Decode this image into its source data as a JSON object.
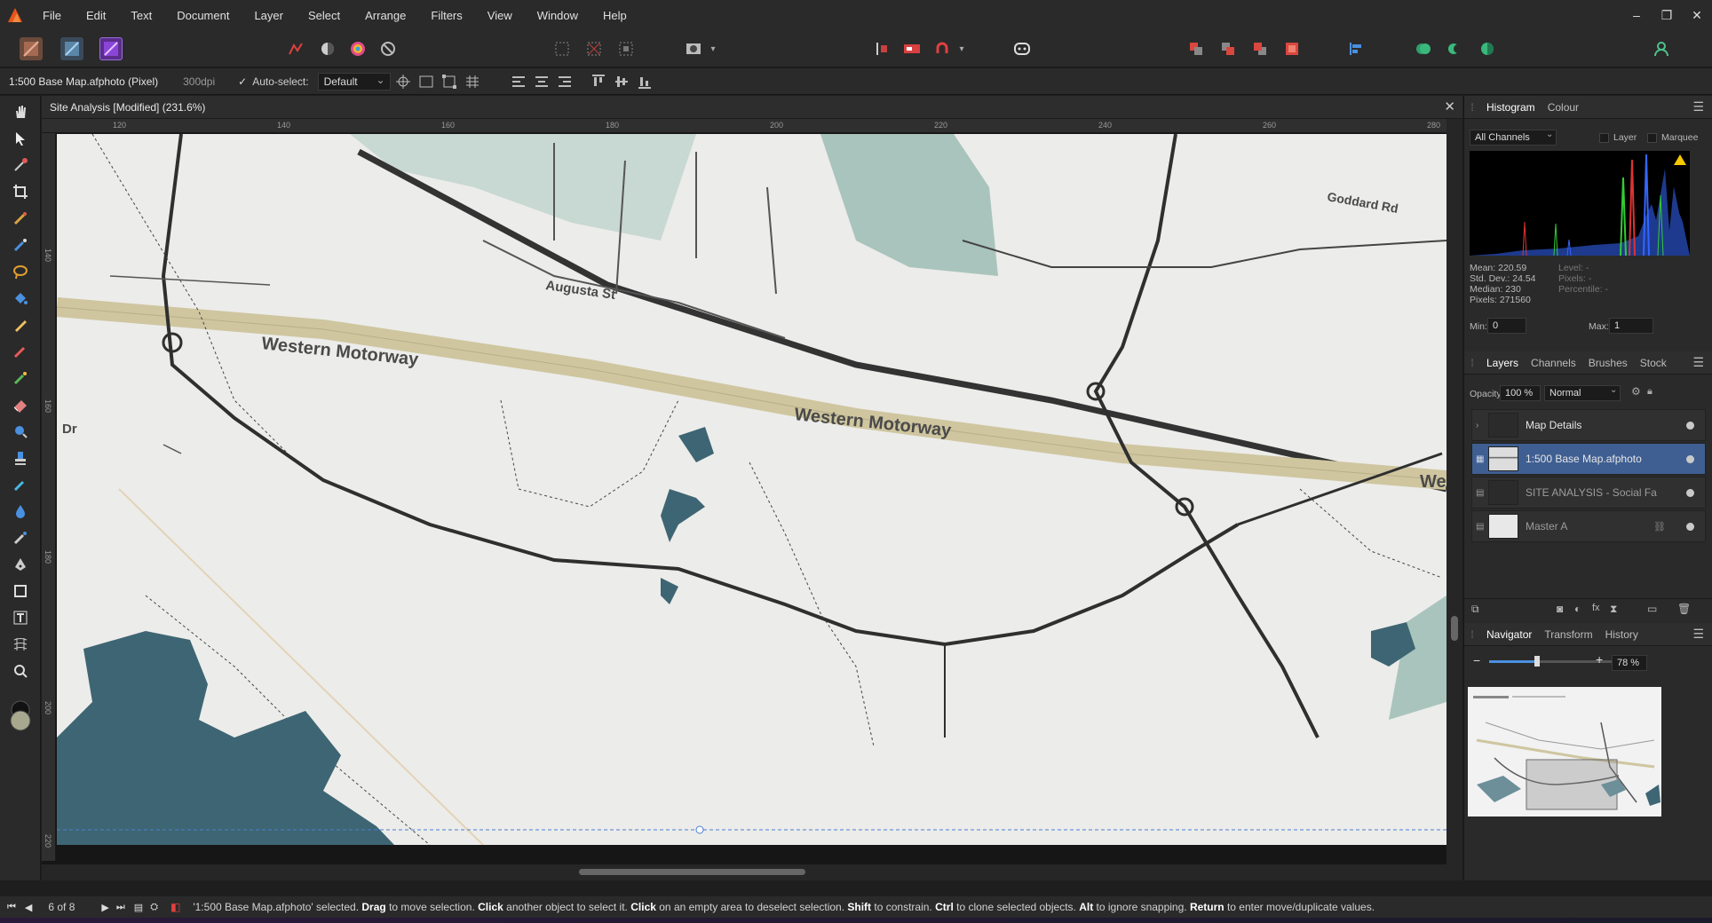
{
  "menubar": {
    "items": [
      "File",
      "Edit",
      "Text",
      "Document",
      "Layer",
      "Select",
      "Arrange",
      "Filters",
      "View",
      "Window",
      "Help"
    ]
  },
  "context": {
    "file_label": "1:500 Base Map.afphoto (Pixel)",
    "dpi": "300dpi",
    "auto_select_label": "Auto-select:",
    "auto_select_value": "Default"
  },
  "document": {
    "tab_title": "Site Analysis [Modified] (231.6%)",
    "ruler_h": [
      "120",
      "140",
      "160",
      "180",
      "200",
      "220",
      "240",
      "260",
      "280"
    ],
    "ruler_v": [
      "140",
      "160",
      "180",
      "200",
      "220"
    ],
    "map_labels": {
      "motorway1": "Western Motorway",
      "motorway2": "Western Motorway",
      "augusta": "Augusta St",
      "goddard": "Goddard Rd",
      "dr": "Dr",
      "we": "We"
    }
  },
  "histogram": {
    "tabs": [
      "Histogram",
      "Colour"
    ],
    "channels": "All Channels",
    "layer_label": "Layer",
    "marquee_label": "Marquee",
    "stats_left": [
      "Mean: 220.59",
      "Std. Dev.: 24.54",
      "Median: 230",
      "Pixels: 271560"
    ],
    "stats_right": [
      "Level: -",
      "Pixels: -",
      "Percentile: -"
    ],
    "min_label": "Min:",
    "min_value": "0",
    "max_label": "Max:",
    "max_value": "1"
  },
  "layers": {
    "tabs": [
      "Layers",
      "Channels",
      "Brushes",
      "Stock"
    ],
    "opacity_label": "Opacity:",
    "opacity_value": "100 %",
    "blend_mode": "Normal",
    "items": [
      {
        "name": "Map Details"
      },
      {
        "name": "1:500 Base Map.afphoto"
      },
      {
        "name": "SITE ANALYSIS - Social Fa"
      },
      {
        "name": "Master A"
      }
    ]
  },
  "navigator": {
    "tabs": [
      "Navigator",
      "Transform",
      "History"
    ],
    "zoom": "78 %",
    "zoom_level": 0.38
  },
  "status": {
    "page": "6 of 8",
    "message_parts": [
      {
        "t": "'1:500 Base Map.afphoto' selected. ",
        "b": false
      },
      {
        "t": "Drag",
        "b": true
      },
      {
        "t": " to move selection. ",
        "b": false
      },
      {
        "t": "Click",
        "b": true
      },
      {
        "t": " another object to select it. ",
        "b": false
      },
      {
        "t": "Click",
        "b": true
      },
      {
        "t": " on an empty area to deselect selection. ",
        "b": false
      },
      {
        "t": "Shift",
        "b": true
      },
      {
        "t": " to constrain. ",
        "b": false
      },
      {
        "t": "Ctrl",
        "b": true
      },
      {
        "t": " to clone selected objects. ",
        "b": false
      },
      {
        "t": "Alt",
        "b": true
      },
      {
        "t": " to ignore snapping. ",
        "b": false
      },
      {
        "t": "Return",
        "b": true
      },
      {
        "t": " to enter move/duplicate values.",
        "b": false
      }
    ]
  },
  "colors": {
    "selection": "#3f5f92",
    "water": "#3e6573",
    "motorway": "#cfc6a0",
    "road": "#2f2f2f"
  }
}
